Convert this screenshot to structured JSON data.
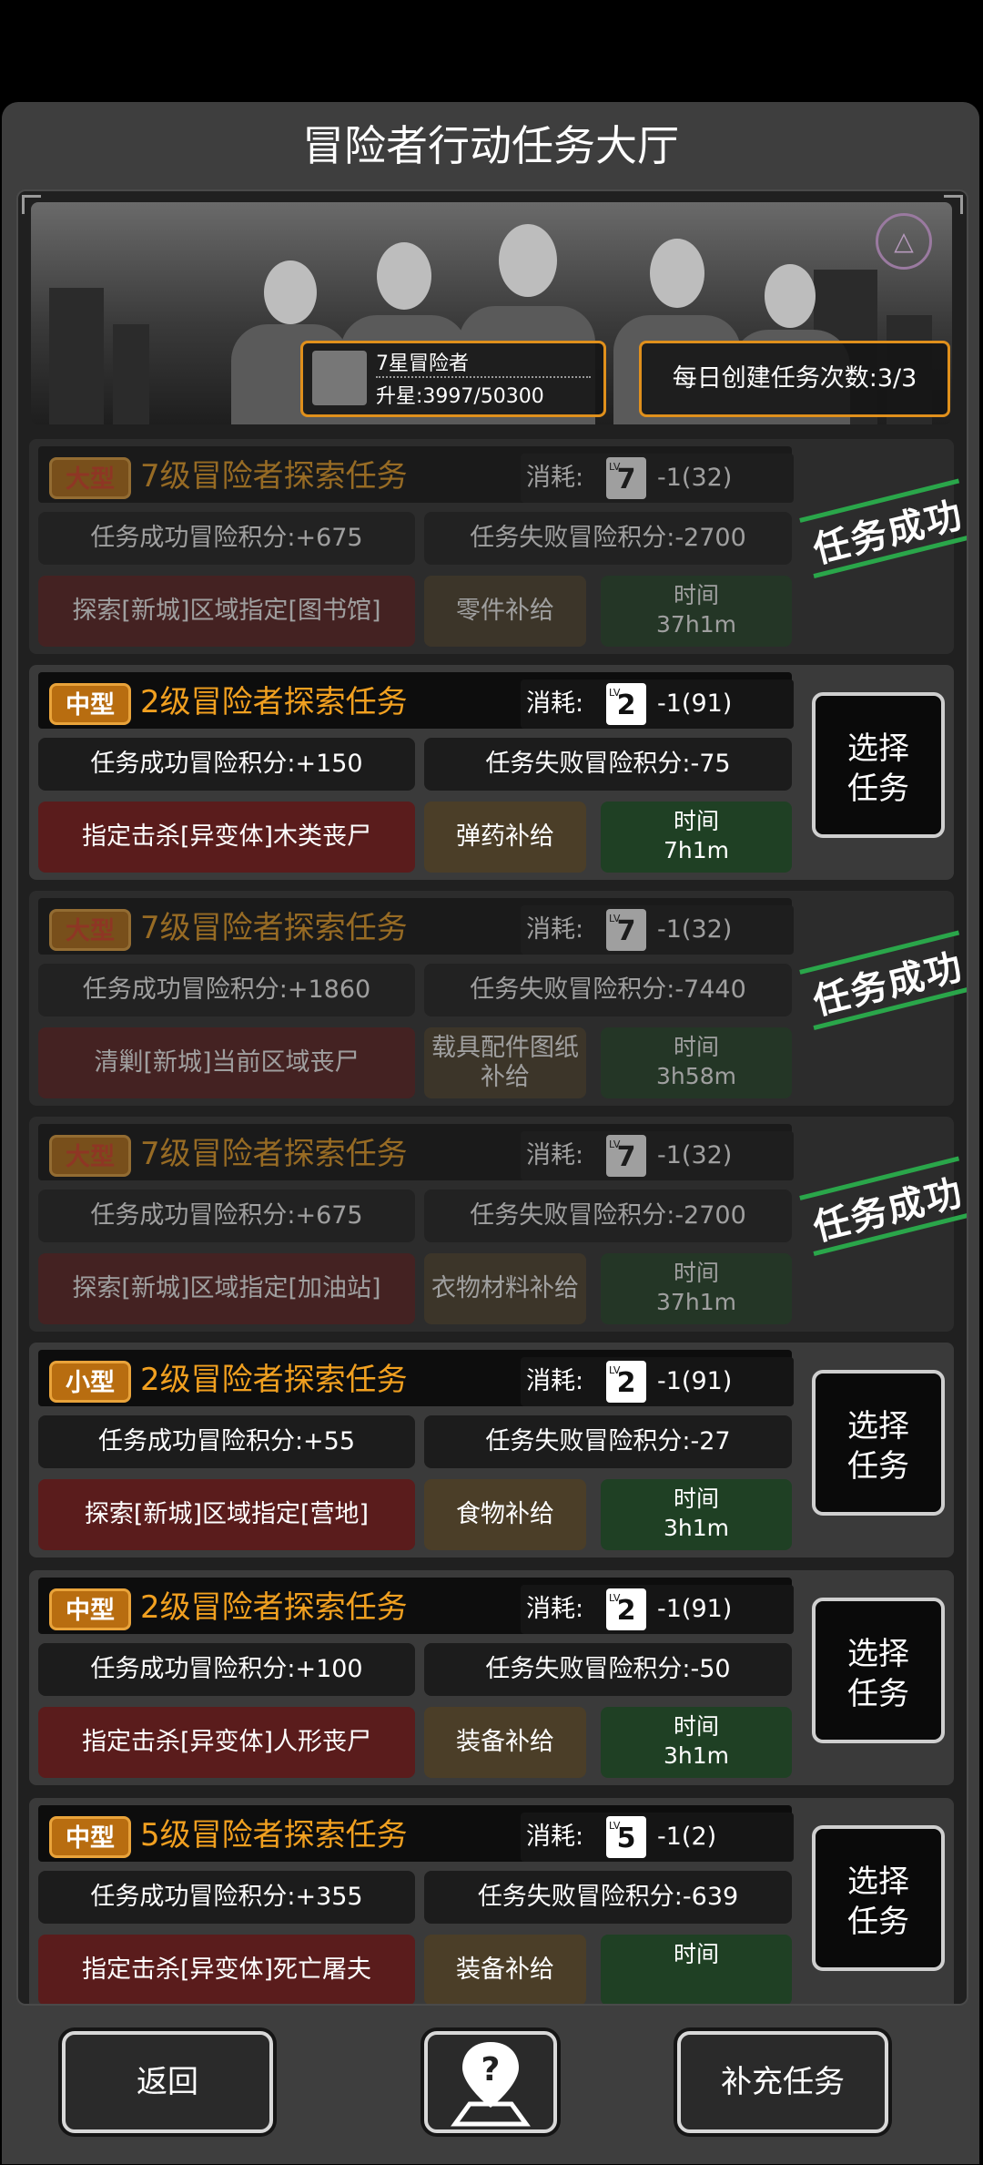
{
  "header": {
    "title": "冒险者行动任务大厅"
  },
  "player": {
    "rank_name": "7星冒险者",
    "progress": "升星:3997/50300",
    "daily": "每日创建任务次数:3/3"
  },
  "labels": {
    "cost": "消耗:",
    "select": [
      "选择",
      "任务"
    ],
    "stamp": "任务成功",
    "time": "时间",
    "lv": "LV."
  },
  "tasks": [
    {
      "size": "大型",
      "title": "7级冒险者探索任务",
      "lv": "7",
      "cost": "-1(32)",
      "success": "任务成功冒险积分:+675",
      "fail": "任务失败冒险积分:-2700",
      "target": "探索[新城]区域指定[图书馆]",
      "supply": "零件补给",
      "time": "37h1m",
      "status": "done"
    },
    {
      "size": "中型",
      "title": "2级冒险者探索任务",
      "lv": "2",
      "cost": "-1(91)",
      "success": "任务成功冒险积分:+150",
      "fail": "任务失败冒险积分:-75",
      "target": "指定击杀[异变体]木类丧尸",
      "supply": "弹药补给",
      "time": "7h1m",
      "status": "open"
    },
    {
      "size": "大型",
      "title": "7级冒险者探索任务",
      "lv": "7",
      "cost": "-1(32)",
      "success": "任务成功冒险积分:+1860",
      "fail": "任务失败冒险积分:-7440",
      "target": "清剿[新城]当前区域丧尸",
      "supply": "载具配件图纸补给",
      "time": "3h58m",
      "status": "done"
    },
    {
      "size": "大型",
      "title": "7级冒险者探索任务",
      "lv": "7",
      "cost": "-1(32)",
      "success": "任务成功冒险积分:+675",
      "fail": "任务失败冒险积分:-2700",
      "target": "探索[新城]区域指定[加油站]",
      "supply": "衣物材料补给",
      "time": "37h1m",
      "status": "done"
    },
    {
      "size": "小型",
      "title": "2级冒险者探索任务",
      "lv": "2",
      "cost": "-1(91)",
      "success": "任务成功冒险积分:+55",
      "fail": "任务失败冒险积分:-27",
      "target": "探索[新城]区域指定[营地]",
      "supply": "食物补给",
      "time": "3h1m",
      "status": "open"
    },
    {
      "size": "中型",
      "title": "2级冒险者探索任务",
      "lv": "2",
      "cost": "-1(91)",
      "success": "任务成功冒险积分:+100",
      "fail": "任务失败冒险积分:-50",
      "target": "指定击杀[异变体]人形丧尸",
      "supply": "装备补给",
      "time": "3h1m",
      "status": "open"
    },
    {
      "size": "中型",
      "title": "5级冒险者探索任务",
      "lv": "5",
      "cost": "-1(2)",
      "success": "任务成功冒险积分:+355",
      "fail": "任务失败冒险积分:-639",
      "target": "指定击杀[异变体]死亡屠夫",
      "supply": "装备补给",
      "time": "",
      "status": "open"
    }
  ],
  "footer": {
    "back": "返回",
    "help_icon": "map-help-icon",
    "refill": "补充任务"
  }
}
